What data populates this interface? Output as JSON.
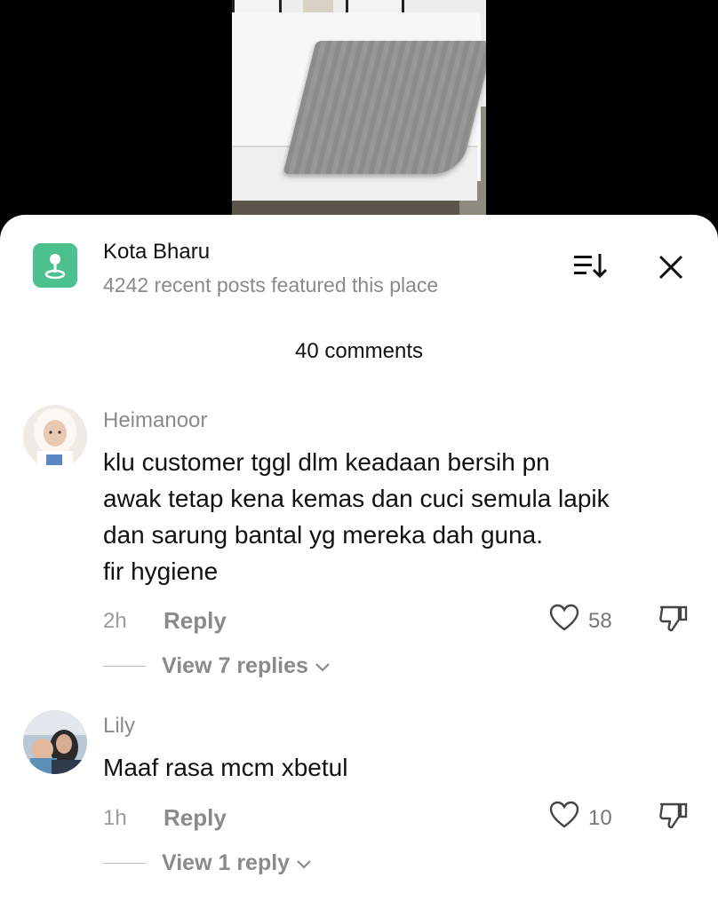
{
  "location": {
    "title": "Kota Bharu",
    "subtitle": "4242 recent posts featured this place"
  },
  "comments_header": {
    "count_label": "40 comments"
  },
  "comments": [
    {
      "username": "Heimanoor",
      "lines": [
        "klu customer tggl dlm keadaan bersih pn",
        "awak tetap kena kemas dan cuci semula lapik",
        "dan sarung bantal yg mereka dah guna.",
        "fir hygiene"
      ],
      "time": "2h",
      "reply_label": "Reply",
      "likes": "58",
      "view_replies": "View 7 replies"
    },
    {
      "username": "Lily",
      "lines": [
        "Maaf rasa mcm xbetul"
      ],
      "time": "1h",
      "reply_label": "Reply",
      "likes": "10",
      "view_replies": "View 1 reply"
    }
  ],
  "colors": {
    "location_icon_bg": "#4cc08e",
    "muted_text": "#8a8a8a"
  },
  "icons": [
    "location-pin-icon",
    "sort-icon",
    "close-icon",
    "heart-icon",
    "dislike-icon",
    "chevron-down-icon"
  ]
}
